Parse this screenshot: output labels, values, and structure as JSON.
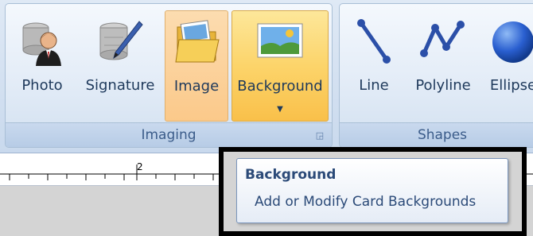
{
  "ribbon": {
    "imaging_group": {
      "label": "Imaging",
      "buttons": [
        {
          "label": "Photo",
          "icon": "user-photo-icon"
        },
        {
          "label": "Signature",
          "icon": "signature-pen-icon"
        },
        {
          "label": "Image",
          "icon": "folder-image-icon"
        },
        {
          "label": "Background",
          "icon": "landscape-image-icon"
        }
      ]
    },
    "shapes_group": {
      "label": "Shapes",
      "buttons": [
        {
          "label": "Line",
          "icon": "line-icon"
        },
        {
          "label": "Polyline",
          "icon": "polyline-icon"
        },
        {
          "label": "Ellipse",
          "icon": "ellipse-icon"
        }
      ]
    }
  },
  "ruler": {
    "mark": "2"
  },
  "tooltip": {
    "title": "Background",
    "description": "Add or Modify Card Backgrounds"
  },
  "colors": {
    "accent_active": "#f9c04a",
    "label_text": "#1e395b",
    "tooltip_text": "#2b4a78"
  }
}
